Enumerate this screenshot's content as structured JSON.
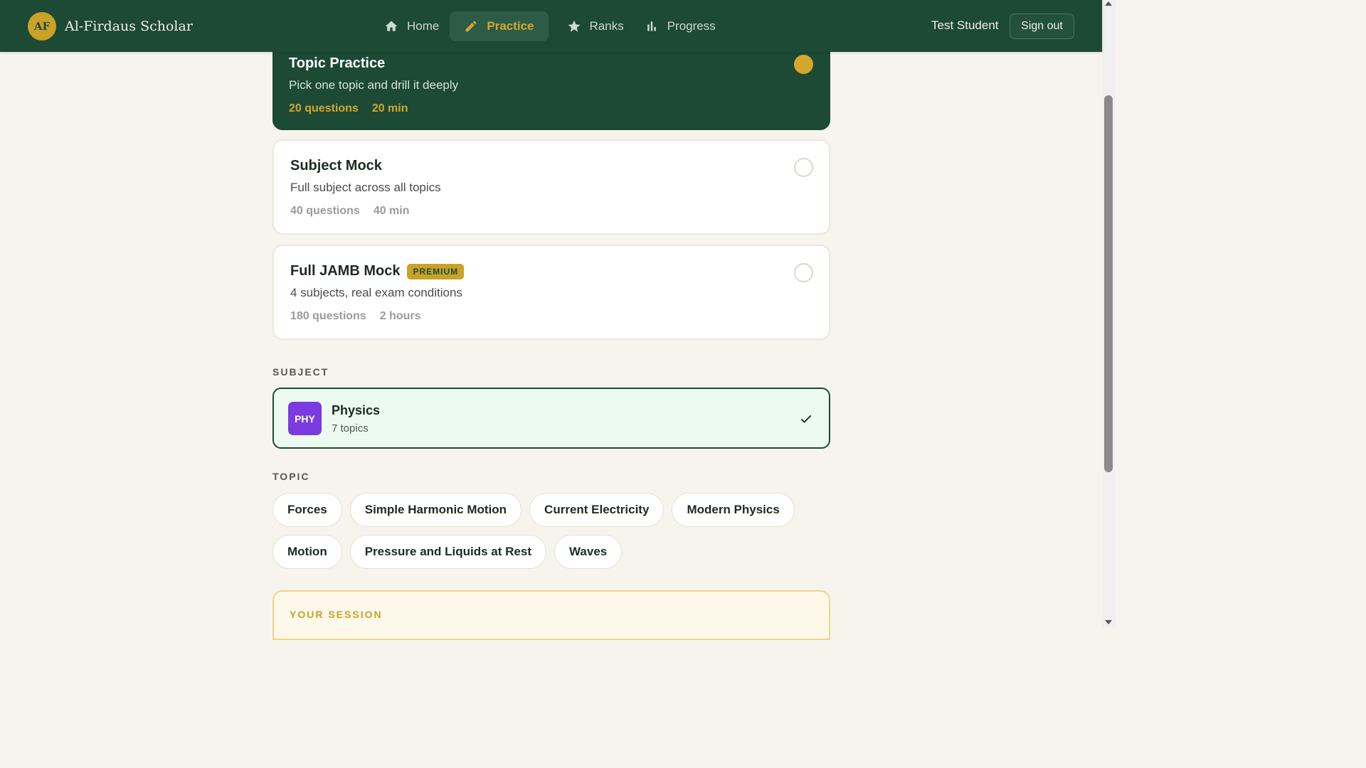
{
  "header": {
    "brand_initials": "AF",
    "brand_name": "Al-Firdaus Scholar",
    "nav": [
      {
        "label": "Home",
        "icon": "home-icon"
      },
      {
        "label": "Practice",
        "icon": "pencil-icon",
        "active": true
      },
      {
        "label": "Ranks",
        "icon": "star-icon"
      },
      {
        "label": "Progress",
        "icon": "bar-chart-icon"
      }
    ],
    "user_name": "Test Student",
    "sign_out": "Sign out"
  },
  "modes": [
    {
      "title": "Topic Practice",
      "desc": "Pick one topic and drill it deeply",
      "questions": "20 questions",
      "time": "20 min",
      "selected": true
    },
    {
      "title": "Subject Mock",
      "desc": "Full subject across all topics",
      "questions": "40 questions",
      "time": "40 min",
      "selected": false
    },
    {
      "title": "Full JAMB Mock",
      "badge": "PREMIUM",
      "desc": "4 subjects, real exam conditions",
      "questions": "180 questions",
      "time": "2 hours",
      "selected": false
    }
  ],
  "subject_section": {
    "label": "SUBJECT",
    "code": "PHY",
    "name": "Physics",
    "count": "7 topics"
  },
  "topic_section": {
    "label": "TOPIC",
    "topics": [
      "Forces",
      "Simple Harmonic Motion",
      "Current Electricity",
      "Modern Physics",
      "Motion",
      "Pressure and Liquids at Rest",
      "Waves"
    ]
  },
  "session": {
    "label": "YOUR SESSION"
  },
  "colors": {
    "primary": "#1c4a35",
    "accent": "#d4a72c",
    "subject": "#7a3be0"
  }
}
